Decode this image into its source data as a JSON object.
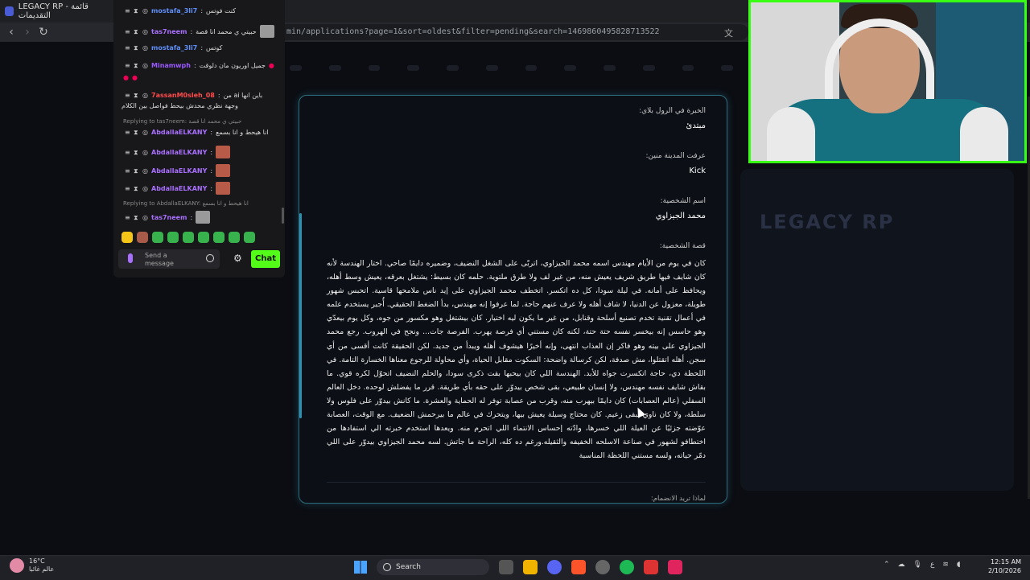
{
  "browser": {
    "tab_title": "LEGACY RP - قائمة التقديمات",
    "url": "min/applications?page=1&sort=oldest&filter=pending&search=1469860495828713522"
  },
  "chat": {
    "messages": [
      {
        "user": "mostafa_3li7",
        "text": "كنت فوتس"
      },
      {
        "user": "tas7neem",
        "text": "حبيتي ي محمد انا قصة"
      },
      {
        "user": "mostafa_3li7",
        "text": "كوتس"
      },
      {
        "user": "Minamwph",
        "text": "جميل اوريون مان دلوقت"
      },
      {
        "user": "7assanM0sleh_08",
        "text": "من ai باين انها",
        "text2": "وجهة نظري محدش بيحط فواصل بين الكلام"
      },
      {
        "reply": "Replying to tas7neem: حبيتي ي محمد انا قصة"
      },
      {
        "user": "AbdallaELKANY",
        "text": "انا هيحط و انا بسمع"
      },
      {
        "user": "AbdallaELKANY",
        "text": ""
      },
      {
        "user": "AbdallaELKANY",
        "text": ""
      },
      {
        "user": "AbdallaELKANY",
        "text": ""
      },
      {
        "reply": "Replying to AbdallaELKANY: انا هيحط و انا بسمع"
      },
      {
        "user": "tas7neem",
        "text": ""
      }
    ],
    "send_placeholder": "Send a message",
    "chat_button": "Chat"
  },
  "application": {
    "experience_label": "الخبرة في الرول بلاي:",
    "experience_value": "مبتدئ",
    "source_label": "عرفت المدينة منين:",
    "source_value": "Kick",
    "character_name_label": "اسم الشخصية:",
    "character_name_value": "محمد الجيزاوي",
    "story_label": "قصة الشخصية:",
    "story_text": "كان في يوم من الأيام مهندس اسمه محمد الجيزاوي، اتربّى على الشغل النضيف، وضميره دايمًا صاحي. اختار الهندسة لأنه كان شايف فيها طريق شريف يعيش منه، من غير لف ولا طرق ملتوية. حلمه كان بسيط: يشتغل بعرقه، يعيش وسط أهله، ويحافظ على أمانه. في ليلة سودا، كل ده اتكسر. اتخطف محمد الجيزاوي على إيد ناس ملامحها قاسية. اتحبس شهور طويلة، معزول عن الدنيا، لا شاف أهله ولا عرف عنهم حاجة. لما عرفوا إنه مهندس، بدأ الضغط الحقيقي. أُجبر يستخدم علمه في أعمال تقنية تخدم تصنيع أسلحة وقنابل، من غير ما يكون ليه اختيار. كان بيشتغل وهو مكسور من جوه، وكل يوم بيعدّي وهو حاسس إنه بيخسر نفسه حتة حتة، لكنه كان مستني أي فرصة يهرب. الفرصة جات... ونجح في الهروب. رجع محمد الجيزاوي على بيته وهو فاكر إن العذاب انتهى، وإنه أخيرًا هيشوف أهله ويبدأ من جديد. لكن الحقيقة كانت أقسى من أي سجن. أهله اتقتلوا، مش صدفة، لكن كرسالة واضحة: السكوت مقابل الحياة، وأي محاولة للرجوع معناها الخسارة التامة. في اللحظة دي، حاجة اتكسرت جواه للأبد. الهندسة اللي كان بيحبها بقت ذكرى سودا، والحلم النضيف اتحوّل لكره قوي. ما بقاش شايف نفسه مهندس، ولا إنسان طبيعي، بقى شخص بيدوّر على حقه بأي طريقة. قرر ما يفضلش لوحده. دخل العالم السفلي (عالم العصابات) كان دايمًا بيهرب منه، وقرب من عصابة توفر له الحماية والعشرة. ما كانش بيدوّر على فلوس ولا سلطة، ولا كان ناوي يبقى زعيم. كان محتاج وسيلة يعيش بيها، ويتحرك في عالم ما بيرحمش الضعيف. مع الوقت، العصابة عوّضته جزئيًا عن العيلة اللي خسرها، وادّته إحساس الانتماء اللي اتحرم منه. ويعدها استخدم خبرته الي استفادها من اختطافو لشهور في صناعة الاسلحه الخفيفه والثقيله.ورغم ده كله، الراحة ما جاتش. لسه محمد الجيزاوي بيدوّر على اللي دمّر حياته، ولسه مستني اللحظة المناسبة",
    "next_label": "لماذا تريد الانضمام:"
  },
  "taskbar": {
    "weather_temp": "16°C",
    "weather_desc": "عالم غائبا",
    "search_label": "Search",
    "tray_lang": "ع",
    "time": "12:15 AM",
    "date": "2/10/2026"
  },
  "colors": {
    "accent_green": "#53fc18",
    "modal_border": "#2d6b7a",
    "cam_border": "#39ff14"
  }
}
